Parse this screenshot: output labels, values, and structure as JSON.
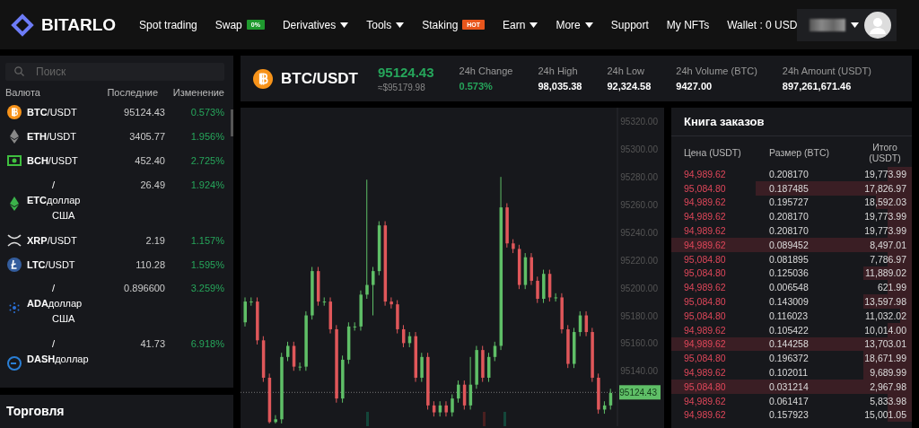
{
  "header": {
    "logo": "BITARLO",
    "nav": [
      {
        "label": "Spot trading",
        "kind": "link"
      },
      {
        "label": "Swap",
        "kind": "badge",
        "badge": "0%",
        "color": "#1f9a2e"
      },
      {
        "label": "Derivatives",
        "kind": "dropdown"
      },
      {
        "label": "Tools",
        "kind": "dropdown"
      },
      {
        "label": "Staking",
        "kind": "badge",
        "badge": "HOT",
        "color": "#e8561c"
      },
      {
        "label": "Earn",
        "kind": "dropdown"
      },
      {
        "label": "More",
        "kind": "dropdown"
      },
      {
        "label": "Support",
        "kind": "link"
      },
      {
        "label": "My NFTs",
        "kind": "link"
      },
      {
        "label": "Wallet : 0 USD",
        "kind": "link"
      }
    ]
  },
  "markets": {
    "search": {
      "placeholder": "Поиск"
    },
    "columns": [
      "Валюта",
      "Последние",
      "Изменение"
    ],
    "rows": [
      {
        "kind": "single",
        "pair": "**BTC**/USDT",
        "last": "95124.43",
        "change": "0.573%"
      },
      {
        "kind": "single",
        "pair": "**ETH**/USDT",
        "last": "3405.77",
        "change": "1.956%"
      },
      {
        "kind": "single",
        "pair": "**BCH**/USDT",
        "last": "452.40",
        "change": "2.725%"
      },
      {
        "kind": "wrapped",
        "lines": [
          "/",
          "**ETC**доллар",
          "США"
        ],
        "last": "26.49",
        "change": "1.924%"
      },
      {
        "kind": "single",
        "pair": "**XRP**/USDT",
        "last": "2.19",
        "change": "1.157%"
      },
      {
        "kind": "single",
        "pair": "**LTC**/USDT",
        "last": "110.28",
        "change": "1.595%"
      },
      {
        "kind": "wrapped",
        "lines": [
          "/",
          "**ADA**доллар",
          "США"
        ],
        "last": "0.896600",
        "change": "3.259%"
      },
      {
        "kind": "wrapped",
        "lines": [
          "/",
          "**DASH**доллар"
        ],
        "last": "41.73",
        "change": "6.918%"
      }
    ]
  },
  "trade": {
    "title": "Торговля"
  },
  "ticker": {
    "pair": "BTC/USDT",
    "price": "95124.43",
    "approx": "≈$95179.98",
    "stats": [
      {
        "label": "24h Change",
        "value": "0.573%",
        "kind": "change"
      },
      {
        "label": "24h High",
        "value": "98,035.38",
        "kind": "plain"
      },
      {
        "label": "24h Low",
        "value": "92,324.58",
        "kind": "plain"
      },
      {
        "label": "24h Volume (BTC)",
        "value": "9427.00",
        "kind": "plain"
      },
      {
        "label": "24h Amount (USDT)",
        "value": "897,261,671.46",
        "kind": "plain"
      }
    ]
  },
  "chart": {
    "chart_data": {
      "type": "candlestick",
      "ylim": [
        95100,
        95330
      ],
      "ref_lines": [
        {
          "axis": "y",
          "value": 95124.43,
          "label": "95124.43"
        }
      ],
      "ohlc": [
        [
          95175,
          95193,
          95172,
          95190
        ],
        [
          95190,
          95193,
          95187,
          95190
        ],
        [
          95190,
          95193,
          95159,
          95162
        ],
        [
          95162,
          95165,
          95132,
          95135
        ],
        [
          95135,
          95138,
          95102,
          95103
        ],
        [
          95103,
          95108,
          95102,
          95105
        ],
        [
          95105,
          95153,
          95102,
          95150
        ],
        [
          95150,
          95161,
          95147,
          95158
        ],
        [
          95158,
          95161,
          95140,
          95143
        ],
        [
          95143,
          95146,
          95140,
          95143
        ],
        [
          95143,
          95183,
          95140,
          95180
        ],
        [
          95180,
          95215,
          95177,
          95212
        ],
        [
          95212,
          95215,
          95187,
          95190
        ],
        [
          95190,
          95193,
          95187,
          95190
        ],
        [
          95190,
          95193,
          95167,
          95170
        ],
        [
          95170,
          95173,
          95117,
          95120
        ],
        [
          95120,
          95151,
          95117,
          95148
        ],
        [
          95148,
          95175,
          95145,
          95172
        ],
        [
          95172,
          95175,
          95169,
          95172
        ],
        [
          95172,
          95198,
          95169,
          95195
        ],
        [
          95195,
          95278,
          95192,
          95202
        ],
        [
          95202,
          95215,
          95180,
          95212
        ],
        [
          95212,
          95248,
          95209,
          95245
        ],
        [
          95245,
          95248,
          95187,
          95190
        ],
        [
          95190,
          95193,
          95185,
          95188
        ],
        [
          95188,
          95191,
          95167,
          95170
        ],
        [
          95170,
          95173,
          95157,
          95160
        ],
        [
          95160,
          95168,
          95157,
          95165
        ],
        [
          95165,
          95168,
          95132,
          95135
        ],
        [
          95135,
          95153,
          95132,
          95150
        ],
        [
          95150,
          95153,
          95112,
          95115
        ],
        [
          95115,
          95118,
          95107,
          95110
        ],
        [
          95110,
          95118,
          95107,
          95115
        ],
        [
          95115,
          95118,
          95107,
          95110
        ],
        [
          95110,
          95123,
          95107,
          95120
        ],
        [
          95120,
          95133,
          95117,
          95130
        ],
        [
          95130,
          95133,
          95112,
          95115
        ],
        [
          95115,
          95150,
          95112,
          95130
        ],
        [
          95130,
          95158,
          95127,
          95155
        ],
        [
          95155,
          95158,
          95132,
          95135
        ],
        [
          95135,
          95153,
          95132,
          95150
        ],
        [
          95150,
          95161,
          95147,
          95158
        ],
        [
          95158,
          95280,
          95155,
          95258
        ],
        [
          95258,
          95261,
          95229,
          95232
        ],
        [
          95232,
          95235,
          95225,
          95228
        ],
        [
          95228,
          95231,
          95199,
          95202
        ],
        [
          95202,
          95225,
          95199,
          95222
        ],
        [
          95222,
          95225,
          95202,
          95205
        ],
        [
          95205,
          95208,
          95189,
          95192
        ],
        [
          95192,
          95213,
          95189,
          95210
        ],
        [
          95210,
          95213,
          95190,
          95193
        ],
        [
          95193,
          95196,
          95190,
          95193
        ],
        [
          95193,
          95196,
          95167,
          95170
        ],
        [
          95170,
          95173,
          95142,
          95145
        ],
        [
          95145,
          95171,
          95142,
          95168
        ],
        [
          95168,
          95183,
          95165,
          95180
        ],
        [
          95180,
          95183,
          95165,
          95168
        ],
        [
          95168,
          95171,
          95132,
          95135
        ],
        [
          95135,
          95138,
          95109,
          95112
        ],
        [
          95112,
          95118,
          95109,
          95115
        ],
        [
          95115,
          95127,
          95112,
          95124
        ]
      ],
      "yticks": [
        {
          "value": 95320,
          "label": "95320.00"
        },
        {
          "value": 95300,
          "label": "95300.00"
        },
        {
          "value": 95280,
          "label": "95280.00"
        },
        {
          "value": 95260,
          "label": "95260.00"
        },
        {
          "value": 95240,
          "label": "95240.00"
        },
        {
          "value": 95220,
          "label": "95220.00"
        },
        {
          "value": 95200,
          "label": "95200.00"
        },
        {
          "value": 95180,
          "label": "95180.00"
        },
        {
          "value": 95160,
          "label": "95160.00"
        },
        {
          "value": 95140,
          "label": "95140.00"
        }
      ]
    }
  },
  "orderbook": {
    "title": "Книга заказов",
    "columns": [
      "Цена (USDT)",
      "Размер (BTC)",
      "Итого (USDT)"
    ],
    "rows": [
      {
        "price": "94,989.62",
        "size": "0.208170",
        "total": "19,773.99"
      },
      {
        "price": "95,084.80",
        "size": "0.187485",
        "total": "17,826.97"
      },
      {
        "price": "94,989.62",
        "size": "0.195727",
        "total": "18,592.03"
      },
      {
        "price": "94,989.62",
        "size": "0.208170",
        "total": "19,773.99"
      },
      {
        "price": "94,989.62",
        "size": "0.208170",
        "total": "19,773.99"
      },
      {
        "price": "94,989.62",
        "size": "0.089452",
        "total": "8,497.01"
      },
      {
        "price": "95,084.80",
        "size": "0.081895",
        "total": "7,786.97"
      },
      {
        "price": "95,084.80",
        "size": "0.125036",
        "total": "11,889.02"
      },
      {
        "price": "94,989.62",
        "size": "0.006548",
        "total": "621.99"
      },
      {
        "price": "95,084.80",
        "size": "0.143009",
        "total": "13,597.98"
      },
      {
        "price": "95,084.80",
        "size": "0.116023",
        "total": "11,032.02"
      },
      {
        "price": "94,989.62",
        "size": "0.105422",
        "total": "10,014.00"
      },
      {
        "price": "94,989.62",
        "size": "0.144258",
        "total": "13,703.01"
      },
      {
        "price": "95,084.80",
        "size": "0.196372",
        "total": "18,671.99"
      },
      {
        "price": "94,989.62",
        "size": "0.102011",
        "total": "9,689.99"
      },
      {
        "price": "95,084.80",
        "size": "0.031214",
        "total": "2,967.98"
      },
      {
        "price": "94,989.62",
        "size": "0.061417",
        "total": "5,833.98"
      },
      {
        "price": "94,989.62",
        "size": "0.157923",
        "total": "15,001.05"
      }
    ]
  }
}
